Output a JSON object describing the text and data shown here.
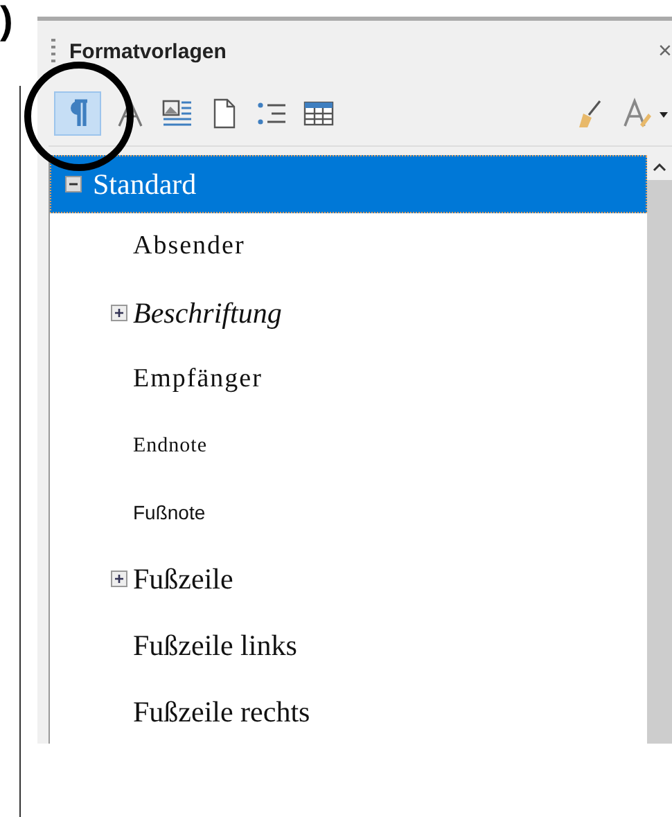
{
  "edge_text": ")",
  "panel": {
    "title": "Formatvorlagen",
    "close": "×"
  },
  "style_families": [
    {
      "selected": true
    },
    {
      "selected": false
    },
    {
      "selected": false
    },
    {
      "selected": false
    },
    {
      "selected": false
    },
    {
      "selected": false
    }
  ],
  "styles": [
    {
      "label": "Standard",
      "kind": "serif",
      "selected": true,
      "expanded": true,
      "children": [
        {
          "label": "Absender",
          "kind": "spaced",
          "selected": false
        },
        {
          "label": "Beschriftung",
          "kind": "italic",
          "selected": false,
          "expanded": false
        },
        {
          "label": "Empfänger",
          "kind": "spaced",
          "selected": false
        },
        {
          "label": "Endnote",
          "kind": "small",
          "selected": false
        },
        {
          "label": "Fußnote",
          "kind": "sans",
          "selected": false
        },
        {
          "label": "Fußzeile",
          "kind": "serif",
          "selected": false,
          "expanded": false
        },
        {
          "label": "Fußzeile links",
          "kind": "serif",
          "selected": false
        },
        {
          "label": "Fußzeile rechts",
          "kind": "serif",
          "selected": false
        }
      ]
    }
  ]
}
